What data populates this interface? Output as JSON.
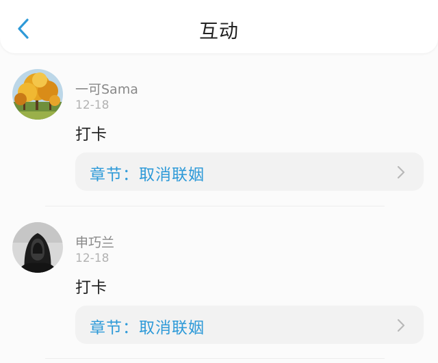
{
  "header": {
    "title": "互动",
    "accent_color": "#2e9ad8"
  },
  "comments": [
    {
      "username": "一可Sama",
      "date": "12-18",
      "content": "打卡",
      "chapter_label": "章节：",
      "chapter_title": "取消联姻",
      "avatar": "autumn-trees-avatar"
    },
    {
      "username": "申巧兰",
      "date": "12-18",
      "content": "打卡",
      "chapter_label": "章节：",
      "chapter_title": "取消联姻",
      "avatar": "hooded-person-avatar"
    }
  ]
}
